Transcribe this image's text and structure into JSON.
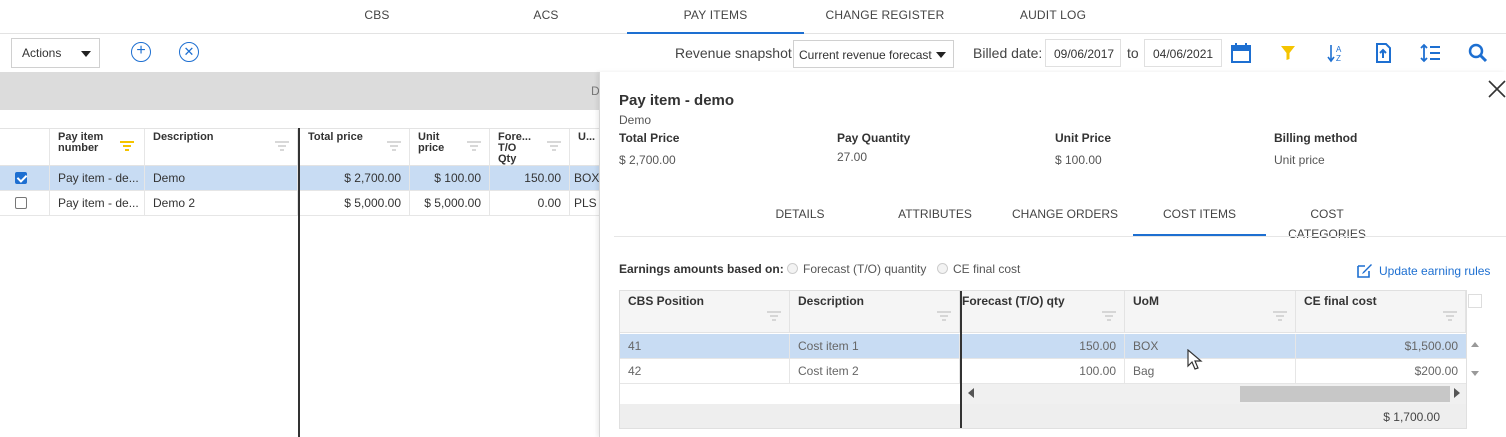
{
  "nav": {
    "tabs": [
      {
        "label": "CBS"
      },
      {
        "label": "ACS"
      },
      {
        "label": "PAY ITEMS",
        "active": true
      },
      {
        "label": "CHANGE REGISTER"
      },
      {
        "label": "AUDIT LOG"
      }
    ]
  },
  "toolbar": {
    "actions_label": "Actions",
    "revenue_snapshot_label": "Revenue snapshot:",
    "revenue_snapshot_value": "Current revenue forecast",
    "billed_date_label": "Billed date:",
    "date_from": "09/06/2017",
    "to_label": "to",
    "date_to": "04/06/2021",
    "icons": [
      "add-icon",
      "remove-icon",
      "calendar-icon",
      "filter-icon",
      "sort-az-icon",
      "export-icon",
      "line-spacing-icon",
      "search-icon"
    ]
  },
  "grid": {
    "band_hint": "D",
    "columns": [
      {
        "label": "Pay item number"
      },
      {
        "label": "Description"
      },
      {
        "label": "Total price"
      },
      {
        "label": "Unit price"
      },
      {
        "label": "Fore... T/O Qty"
      },
      {
        "label": "U..."
      }
    ],
    "rows": [
      {
        "checked": true,
        "pay_item": "Pay item - de...",
        "description": "Demo",
        "total_price": "$ 2,700.00",
        "unit_price": "$ 100.00",
        "qty": "150.00",
        "uom": "BOX"
      },
      {
        "checked": false,
        "pay_item": "Pay item - de...",
        "description": "Demo 2",
        "total_price": "$ 5,000.00",
        "unit_price": "$ 5,000.00",
        "qty": "0.00",
        "uom": "PLS"
      }
    ]
  },
  "detail": {
    "title": "Pay item - demo",
    "subtitle": "Demo",
    "fields": [
      {
        "label": "Total Price",
        "value": "$ 2,700.00"
      },
      {
        "label": "Pay Quantity",
        "value": "27.00"
      },
      {
        "label": "Unit Price",
        "value": "$ 100.00"
      },
      {
        "label": "Billing method",
        "value": "Unit price"
      }
    ],
    "tabs": [
      {
        "label": "DETAILS"
      },
      {
        "label": "ATTRIBUTES"
      },
      {
        "label": "CHANGE ORDERS"
      },
      {
        "label": "COST ITEMS",
        "active": true
      },
      {
        "label": "COST CATEGORIES"
      }
    ],
    "earnings_label": "Earnings amounts based on:",
    "radio_forecast": "Forecast (T/O) quantity",
    "radio_ce": "CE final cost",
    "update_rules": "Update earning rules",
    "cost_grid": {
      "columns": [
        {
          "label": "CBS Position"
        },
        {
          "label": "Description"
        },
        {
          "label": "Forecast (T/O) qty"
        },
        {
          "label": "UoM"
        },
        {
          "label": "CE final cost"
        }
      ],
      "rows": [
        {
          "cbs": "41",
          "description": "Cost item 1",
          "qty": "150.00",
          "uom": "BOX",
          "cost": "$1,500.00"
        },
        {
          "cbs": "42",
          "description": "Cost item 2",
          "qty": "100.00",
          "uom": "Bag",
          "cost": "$200.00"
        }
      ],
      "total": "$ 1,700.00"
    }
  },
  "colors": {
    "accent": "#1d6fd1",
    "selected_row": "#c8dcf3",
    "filter_active": "#f5c400"
  }
}
